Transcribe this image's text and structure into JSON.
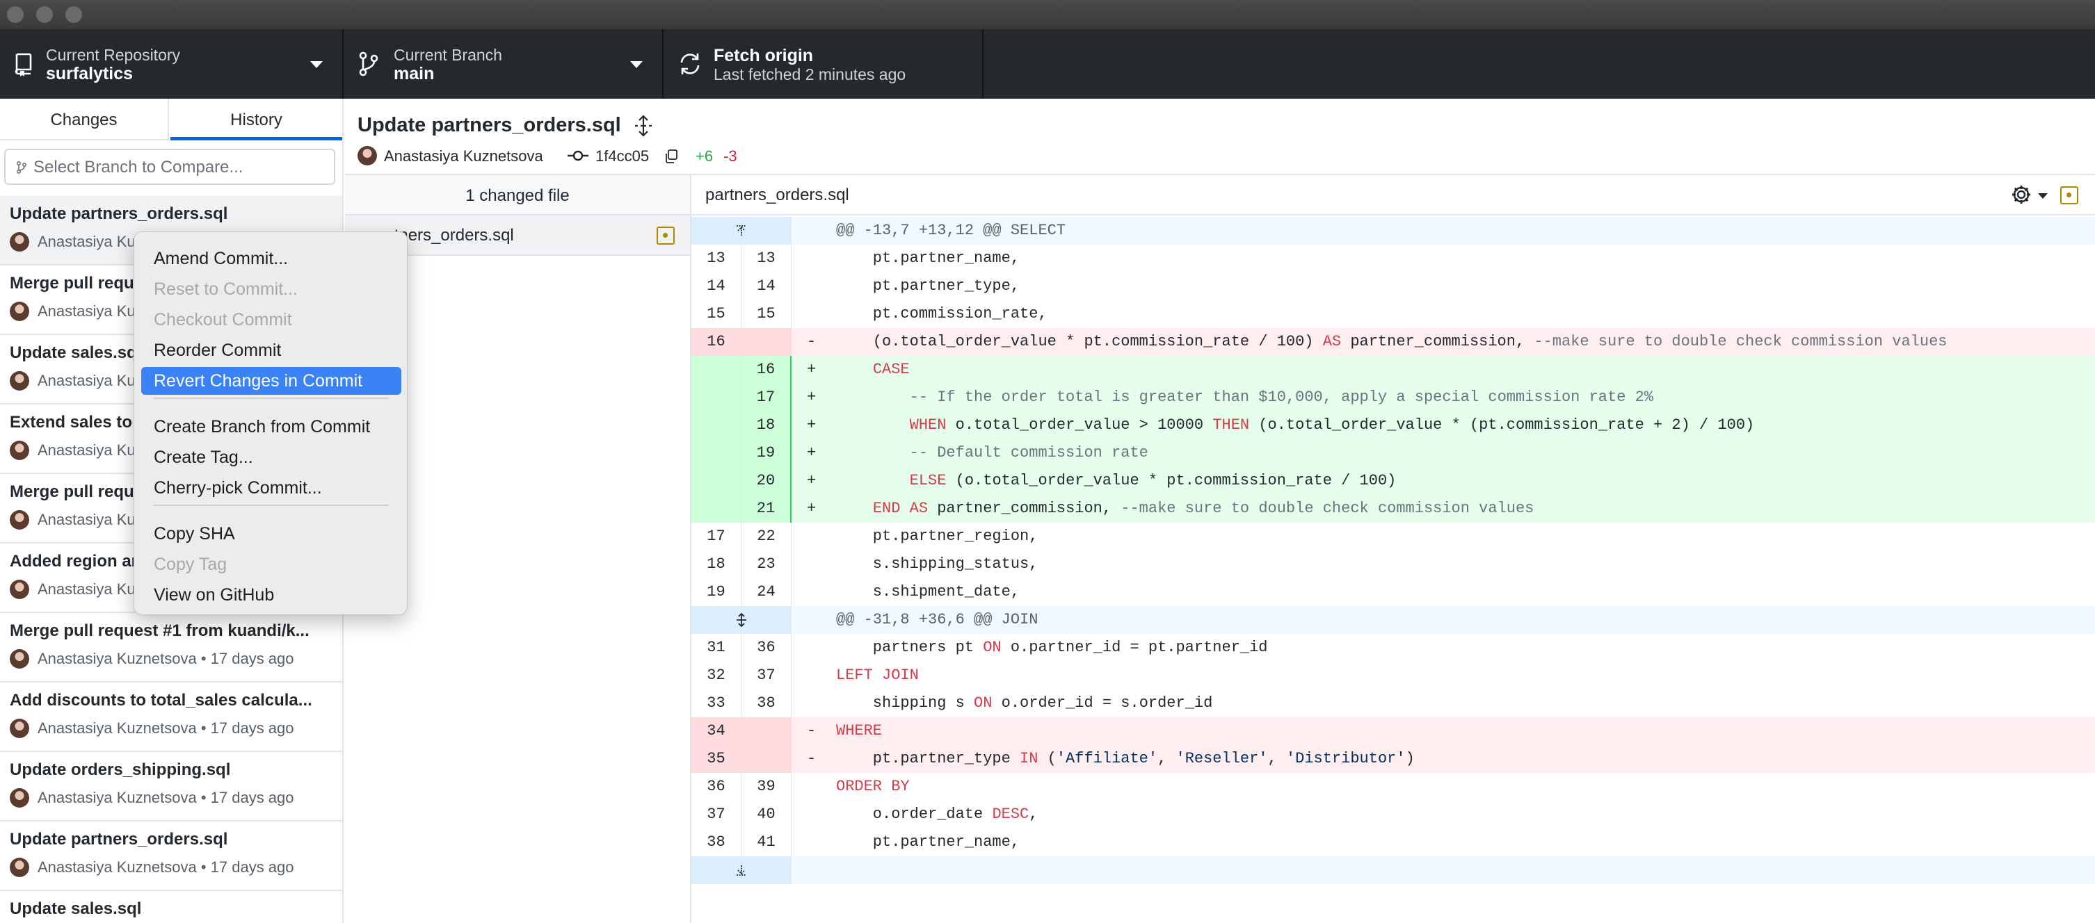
{
  "toolbar": {
    "repository": {
      "label": "Current Repository",
      "value": "surfalytics"
    },
    "branch": {
      "label": "Current Branch",
      "value": "main"
    },
    "fetch": {
      "title": "Fetch origin",
      "subtitle": "Last fetched 2 minutes ago"
    }
  },
  "sidebar": {
    "tabs": [
      {
        "label": "Changes"
      },
      {
        "label": "History"
      }
    ],
    "branch_placeholder": "Select Branch to Compare...",
    "commits": [
      {
        "title": "Update partners_orders.sql",
        "author": "Anastasiya Kuznetsova",
        "time": ""
      },
      {
        "title": "Merge pull request #2 from kuandi/k...",
        "author": "Anastasiya Kuznetsova",
        "time": ""
      },
      {
        "title": "Update sales.sql",
        "author": "Anastasiya Kuznetsova",
        "time": ""
      },
      {
        "title": "Extend sales to include new columns",
        "author": "Anastasiya Kuznetsova",
        "time": ""
      },
      {
        "title": "Merge pull request #1 from kuandi/k...",
        "author": "Anastasiya Kuznetsova",
        "time": ""
      },
      {
        "title": "Added region and partner columns",
        "author": "Anastasiya Kuznetsova",
        "time": ""
      },
      {
        "title": "Merge pull request #1 from kuandi/k...",
        "author": "Anastasiya Kuznetsova",
        "time": "17 days ago"
      },
      {
        "title": "Add discounts to total_sales calcula...",
        "author": "Anastasiya Kuznetsova",
        "time": "17 days ago"
      },
      {
        "title": "Update orders_shipping.sql",
        "author": "Anastasiya Kuznetsova",
        "time": "17 days ago"
      },
      {
        "title": "Update partners_orders.sql",
        "author": "Anastasiya Kuznetsova",
        "time": "17 days ago"
      },
      {
        "title": "Update sales.sql",
        "author": "",
        "time": ""
      }
    ]
  },
  "commit": {
    "title": "Update partners_orders.sql",
    "author": "Anastasiya Kuznetsova",
    "sha": "1f4cc05",
    "additions": "+6",
    "deletions": "-3"
  },
  "files": {
    "header": "1 changed file",
    "items": [
      {
        "name": "partners_orders.sql",
        "status": "modified"
      }
    ]
  },
  "diff": {
    "filename": "partners_orders.sql",
    "lines": [
      {
        "type": "hunk",
        "old": "",
        "new": "",
        "marker": "",
        "code": "@@ -13,7 +13,12 @@ SELECT"
      },
      {
        "type": "ctx",
        "old": "13",
        "new": "13",
        "marker": "",
        "code": "    pt.partner_name,"
      },
      {
        "type": "ctx",
        "old": "14",
        "new": "14",
        "marker": "",
        "code": "    pt.partner_type,"
      },
      {
        "type": "ctx",
        "old": "15",
        "new": "15",
        "marker": "",
        "code": "    pt.commission_rate,"
      },
      {
        "type": "del",
        "old": "16",
        "new": "",
        "marker": "-",
        "code": "    (o.total_order_value * pt.commission_rate / 100) AS partner_commission, --make sure to double check commission values"
      },
      {
        "type": "add",
        "old": "",
        "new": "16",
        "marker": "+",
        "code": "    CASE"
      },
      {
        "type": "add",
        "old": "",
        "new": "17",
        "marker": "+",
        "code": "        -- If the order total is greater than $10,000, apply a special commission rate 2%"
      },
      {
        "type": "add",
        "old": "",
        "new": "18",
        "marker": "+",
        "code": "        WHEN o.total_order_value > 10000 THEN (o.total_order_value * (pt.commission_rate + 2) / 100)"
      },
      {
        "type": "add",
        "old": "",
        "new": "19",
        "marker": "+",
        "code": "        -- Default commission rate"
      },
      {
        "type": "add",
        "old": "",
        "new": "20",
        "marker": "+",
        "code": "        ELSE (o.total_order_value * pt.commission_rate / 100)"
      },
      {
        "type": "add",
        "old": "",
        "new": "21",
        "marker": "+",
        "code": "    END AS partner_commission, --make sure to double check commission values"
      },
      {
        "type": "ctx",
        "old": "17",
        "new": "22",
        "marker": "",
        "code": "    pt.partner_region,"
      },
      {
        "type": "ctx",
        "old": "18",
        "new": "23",
        "marker": "",
        "code": "    s.shipping_status,"
      },
      {
        "type": "ctx",
        "old": "19",
        "new": "24",
        "marker": "",
        "code": "    s.shipment_date,"
      },
      {
        "type": "hunk",
        "old": "",
        "new": "",
        "marker": "",
        "code": "@@ -31,8 +36,6 @@ JOIN"
      },
      {
        "type": "ctx",
        "old": "31",
        "new": "36",
        "marker": "",
        "code": "    partners pt ON o.partner_id = pt.partner_id"
      },
      {
        "type": "ctx",
        "old": "32",
        "new": "37",
        "marker": "",
        "code": "LEFT JOIN"
      },
      {
        "type": "ctx",
        "old": "33",
        "new": "38",
        "marker": "",
        "code": "    shipping s ON o.order_id = s.order_id"
      },
      {
        "type": "del",
        "old": "34",
        "new": "",
        "marker": "-",
        "code": "WHERE"
      },
      {
        "type": "del",
        "old": "35",
        "new": "",
        "marker": "-",
        "code": "    pt.partner_type IN ('Affiliate', 'Reseller', 'Distributor')"
      },
      {
        "type": "ctx",
        "old": "36",
        "new": "39",
        "marker": "",
        "code": "ORDER BY"
      },
      {
        "type": "ctx",
        "old": "37",
        "new": "40",
        "marker": "",
        "code": "    o.order_date DESC,"
      },
      {
        "type": "ctx",
        "old": "38",
        "new": "41",
        "marker": "",
        "code": "    pt.partner_name,"
      },
      {
        "type": "hunk",
        "old": "",
        "new": "",
        "marker": "",
        "code": ""
      }
    ]
  },
  "context_menu": {
    "items": [
      {
        "label": "Amend Commit...",
        "enabled": true
      },
      {
        "label": "Reset to Commit...",
        "enabled": false
      },
      {
        "label": "Checkout Commit",
        "enabled": false
      },
      {
        "label": "Reorder Commit",
        "enabled": true
      },
      {
        "label": "Revert Changes in Commit",
        "enabled": true,
        "highlighted": true
      },
      {
        "label": "Create Branch from Commit",
        "enabled": true
      },
      {
        "label": "Create Tag...",
        "enabled": true
      },
      {
        "label": "Cherry-pick Commit...",
        "enabled": true
      },
      {
        "label": "Copy SHA",
        "enabled": true
      },
      {
        "label": "Copy Tag",
        "enabled": false
      },
      {
        "label": "View on GitHub",
        "enabled": true
      }
    ]
  },
  "colors": {
    "toolbar_bg": "#24292e",
    "accent": "#0366d6",
    "added": "#28a745",
    "deleted": "#cb2431",
    "menu_highlight": "#3b82f6",
    "modified": "#b08800"
  }
}
